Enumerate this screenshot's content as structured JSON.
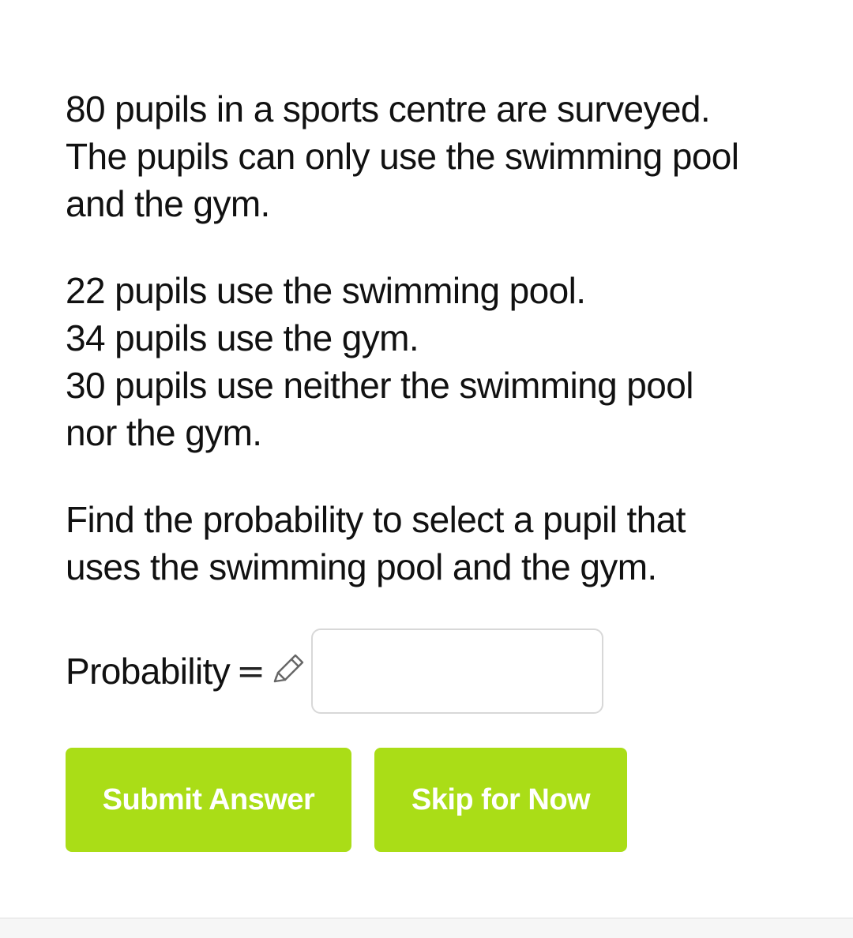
{
  "question": {
    "paragraph1": [
      "80 pupils in a sports centre are surveyed.",
      "The pupils can only use the swimming pool",
      "and the gym."
    ],
    "paragraph2": [
      "22 pupils use the swimming pool.",
      "34 pupils use the gym.",
      "30 pupils use neither the swimming pool",
      "nor the gym."
    ],
    "paragraph3": [
      "Find the probability to select a pupil that",
      "uses the swimming pool and the gym."
    ]
  },
  "answer": {
    "label": "Probability",
    "equals": "=",
    "value": "",
    "pencil_icon": "pencil-icon"
  },
  "buttons": {
    "submit_label": "Submit Answer",
    "skip_label": "Skip for Now"
  },
  "colors": {
    "button_bg": "#aadd17",
    "button_text": "#ffffff"
  }
}
